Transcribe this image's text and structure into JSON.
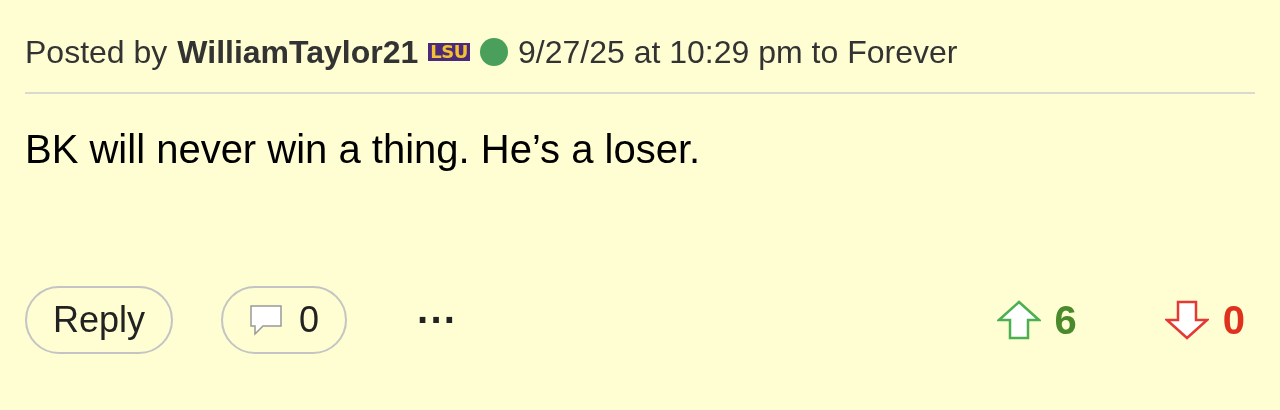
{
  "post": {
    "posted_by_label": "Posted by",
    "author": "WilliamTaylor21",
    "team_badge": "LSU",
    "online": true,
    "timestamp": "9/27/25 at 10:29 pm to Forever",
    "body": "BK will never win a thing. He’s a loser.",
    "reply_button": "Reply",
    "comment_count": "0",
    "more_button": "···",
    "upvotes": "6",
    "downvotes": "0"
  }
}
